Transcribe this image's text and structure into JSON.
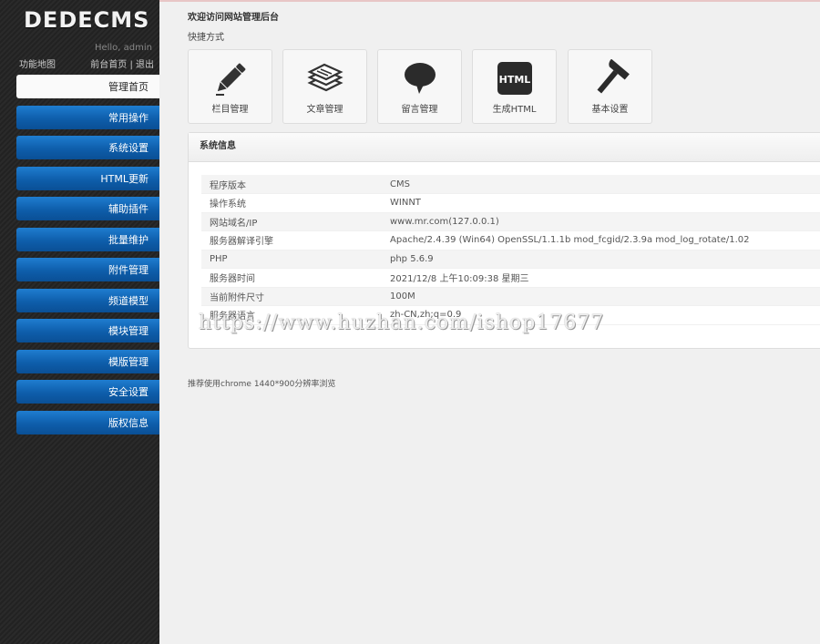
{
  "sidebar": {
    "logo": "DEDECMS",
    "hello": "Hello, admin",
    "map_link": "功能地图",
    "front_link": "前台首页",
    "separator": "|",
    "logout_link": "退出",
    "items": [
      {
        "label": "管理首页"
      },
      {
        "label": "常用操作"
      },
      {
        "label": "系统设置"
      },
      {
        "label": "HTML更新"
      },
      {
        "label": "辅助插件"
      },
      {
        "label": "批量维护"
      },
      {
        "label": "附件管理"
      },
      {
        "label": "频道模型"
      },
      {
        "label": "模块管理"
      },
      {
        "label": "模版管理"
      },
      {
        "label": "安全设置"
      },
      {
        "label": "版权信息"
      }
    ],
    "active_index": 0,
    "accent_color": "#0e5eab"
  },
  "main": {
    "welcome": "欢迎访问网站管理后台",
    "shortcuts_title": "快捷方式",
    "shortcuts": [
      {
        "label": "栏目管理",
        "icon": "pencil-icon"
      },
      {
        "label": "文章管理",
        "icon": "papers-icon"
      },
      {
        "label": "留言管理",
        "icon": "speech-bubble-icon"
      },
      {
        "label": "生成HTML",
        "icon": "html-icon",
        "icon_text": "HTML"
      },
      {
        "label": "基本设置",
        "icon": "hammer-icon"
      }
    ],
    "sysinfo": {
      "title": "系统信息",
      "rows": [
        {
          "key": "程序版本",
          "value": "CMS"
        },
        {
          "key": "操作系统",
          "value": "WINNT"
        },
        {
          "key": "网站域名/IP",
          "value": "www.mr.com(127.0.0.1)"
        },
        {
          "key": "服务器解译引擎",
          "value": "Apache/2.4.39 (Win64) OpenSSL/1.1.1b mod_fcgid/2.3.9a mod_log_rotate/1.02"
        },
        {
          "key": "PHP",
          "value": "php 5.6.9"
        },
        {
          "key": "服务器时间",
          "value": "2021/12/8 上午10:09:38 星期三"
        },
        {
          "key": "当前附件尺寸",
          "value": "100M"
        },
        {
          "key": "服务器语言",
          "value": "zh-CN,zh;q=0.9"
        }
      ]
    },
    "watermark": "https://www.huzhan.com/ishop17677",
    "footer_note": "推荐使用chrome 1440*900分辨率浏览"
  }
}
